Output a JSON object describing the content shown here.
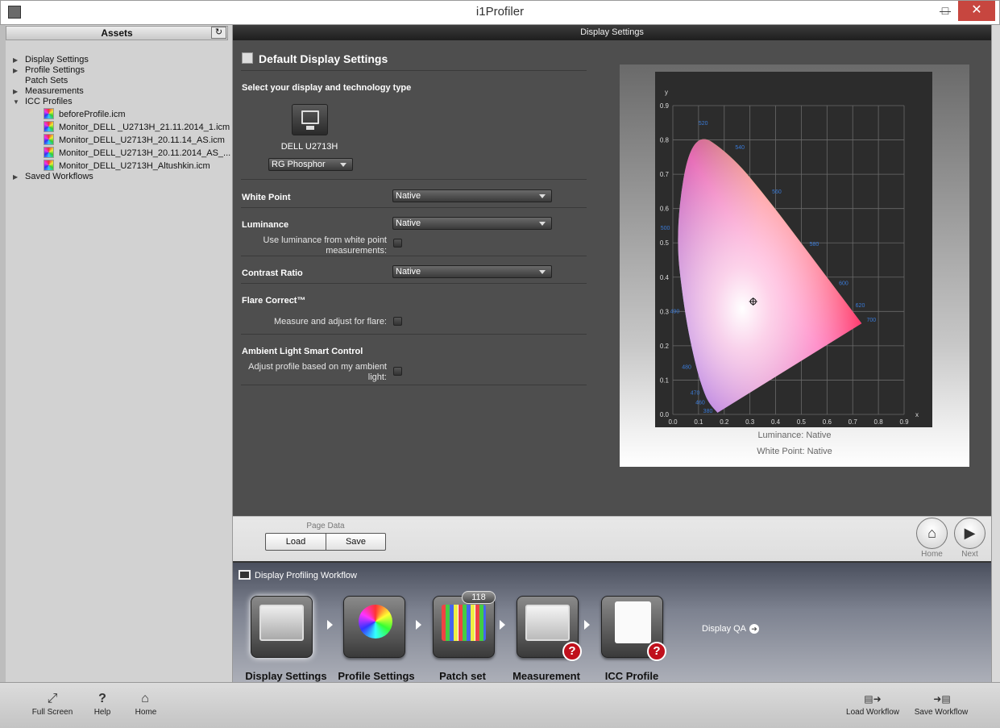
{
  "window": {
    "title": "i1Profiler"
  },
  "assets": {
    "title": "Assets",
    "tree": [
      {
        "label": "Display Settings",
        "expanded": false
      },
      {
        "label": "Profile Settings",
        "expanded": false
      },
      {
        "label": "Patch Sets",
        "expanded": false
      },
      {
        "label": "Measurements",
        "expanded": false
      },
      {
        "label": "ICC Profiles",
        "expanded": true
      },
      {
        "label": "Saved Workflows",
        "expanded": false
      }
    ],
    "icc_files": [
      "beforeProfile.icm",
      "Monitor_DELL _U2713H_21.11.2014_1.icm",
      "Monitor_DELL_U2713H_20.11.14_AS.icm",
      "Monitor_DELL_U2713H_20.11.2014_AS_...",
      "Monitor_DELL_U2713H_Altushkin.icm"
    ]
  },
  "main": {
    "header": "Display Settings",
    "section_title": "Default Display Settings",
    "select_label": "Select your display and technology type",
    "display_name": "DELL U2713H",
    "technology": "RG Phosphor",
    "white_point": {
      "label": "White Point",
      "value": "Native"
    },
    "luminance": {
      "label": "Luminance",
      "value": "Native",
      "option_label": "Use luminance from white point measurements:",
      "checked": false
    },
    "contrast": {
      "label": "Contrast Ratio",
      "value": "Native"
    },
    "flare": {
      "label": "Flare Correct™",
      "option_label": "Measure and adjust for flare:",
      "checked": false
    },
    "ambient": {
      "label": "Ambient Light Smart Control",
      "option_label": "Adjust profile based on my ambient light:",
      "checked": false
    }
  },
  "chart": {
    "luminance_text": "Luminance:  Native",
    "white_point_text": "White Point: Native",
    "x_axis_title": "x",
    "y_axis_title": "y",
    "x_ticks": [
      "0.0",
      "0.1",
      "0.2",
      "0.3",
      "0.4",
      "0.5",
      "0.6",
      "0.7",
      "0.8",
      "0.9"
    ],
    "y_ticks": [
      "0.0",
      "0.1",
      "0.2",
      "0.3",
      "0.4",
      "0.5",
      "0.6",
      "0.7",
      "0.8",
      "0.9"
    ],
    "wavelength_labels": [
      "380",
      "460",
      "470",
      "480",
      "490",
      "500",
      "520",
      "540",
      "560",
      "580",
      "600",
      "620",
      "700"
    ]
  },
  "chart_data": {
    "type": "scatter",
    "title": "",
    "xlabel": "x",
    "ylabel": "y",
    "xlim": [
      0,
      0.9
    ],
    "ylim": [
      0,
      0.9
    ],
    "grid": true,
    "spectral_locus": [
      {
        "nm": "380",
        "x": 0.1741,
        "y": 0.005
      },
      {
        "nm": "460",
        "x": 0.144,
        "y": 0.0297
      },
      {
        "nm": "470",
        "x": 0.1241,
        "y": 0.0578
      },
      {
        "nm": "480",
        "x": 0.0913,
        "y": 0.1327
      },
      {
        "nm": "490",
        "x": 0.0454,
        "y": 0.295
      },
      {
        "nm": "500",
        "x": 0.0082,
        "y": 0.5384
      },
      {
        "nm": "520",
        "x": 0.0743,
        "y": 0.8338
      },
      {
        "nm": "540",
        "x": 0.2296,
        "y": 0.7543
      },
      {
        "nm": "560",
        "x": 0.3731,
        "y": 0.6245
      },
      {
        "nm": "580",
        "x": 0.5125,
        "y": 0.4866
      },
      {
        "nm": "600",
        "x": 0.627,
        "y": 0.3725
      },
      {
        "nm": "620",
        "x": 0.6915,
        "y": 0.3083
      },
      {
        "nm": "700",
        "x": 0.7347,
        "y": 0.2653
      }
    ],
    "marker": {
      "x": 0.3127,
      "y": 0.329
    }
  },
  "nav": {
    "page_data_label": "Page Data",
    "load": "Load",
    "save": "Save",
    "home": "Home",
    "next": "Next"
  },
  "workflow": {
    "title": "Display Profiling Workflow",
    "steps": [
      {
        "label": "Display Settings",
        "warning": false
      },
      {
        "label": "Profile Settings",
        "warning": false
      },
      {
        "label": "Patch set",
        "warning": false,
        "badge": "118"
      },
      {
        "label": "Measurement",
        "warning": true
      },
      {
        "label": "ICC Profile",
        "warning": true
      }
    ],
    "qa_label": "Display QA",
    "warning_glyph": "?"
  },
  "bottom": {
    "full_screen": "Full Screen",
    "help": "Help",
    "home": "Home",
    "load_workflow": "Load Workflow",
    "save_workflow": "Save Workflow"
  }
}
